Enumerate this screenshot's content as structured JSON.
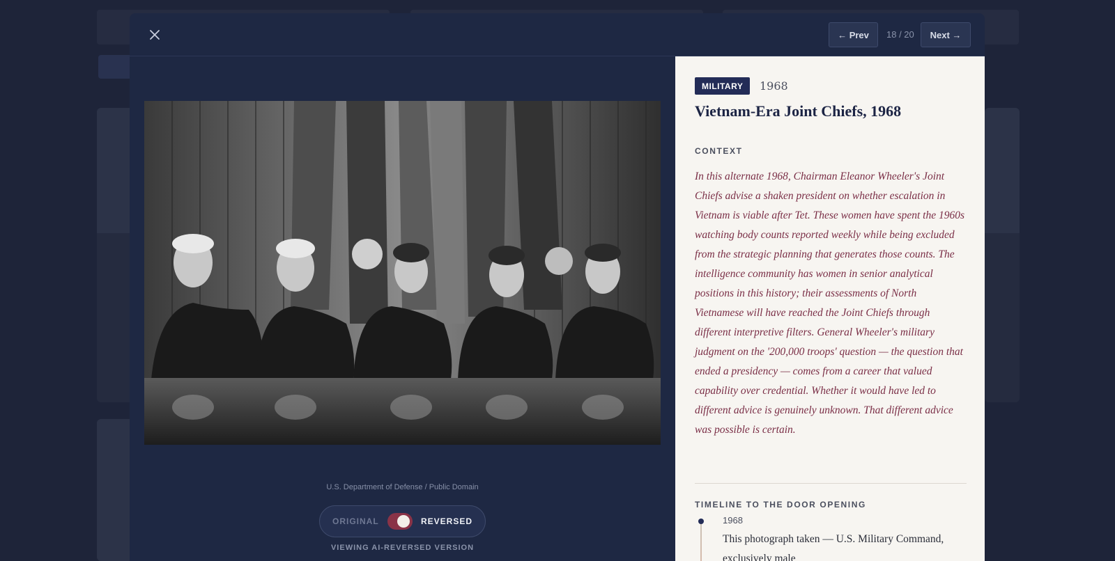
{
  "header": {
    "prev_label": "← Prev",
    "counter": "18 / 20",
    "next_label": "Next →"
  },
  "photo": {
    "credit": "U.S. Department of Defense / Public Domain"
  },
  "toggle": {
    "original_label": "ORIGINAL",
    "reversed_label": "REVERSED",
    "viewing_label": "VIEWING AI-REVERSED VERSION"
  },
  "detail": {
    "category": "MILITARY",
    "year": "1968",
    "title": "Vietnam-Era Joint Chiefs, 1968",
    "context_heading": "CONTEXT",
    "context_text": "In this alternate 1968, Chairman Eleanor Wheeler's Joint Chiefs advise a shaken president on whether escalation in Vietnam is viable after Tet. These women have spent the 1960s watching body counts reported weekly while being excluded from the strategic planning that generates those counts. The intelligence community has women in senior analytical positions in this history; their assessments of North Vietnamese will have reached the Joint Chiefs through different interpretive filters. General Wheeler's military judgment on the '200,000 troops' question — the question that ended a presidency — comes from a career that valued capability over credential. Whether it would have led to different advice is genuinely unknown. That different advice was possible is certain.",
    "timeline_heading": "TIMELINE TO THE DOOR OPENING",
    "timeline": [
      {
        "year": "1968",
        "text": "This photograph taken — U.S. Military Command, exclusively male"
      }
    ]
  },
  "colors": {
    "modal_bg": "#1e2843",
    "panel_bg": "#f7f5f1",
    "badge_bg": "#232c57",
    "context_text": "#7a2e46",
    "toggle_on": "#8a3347"
  }
}
